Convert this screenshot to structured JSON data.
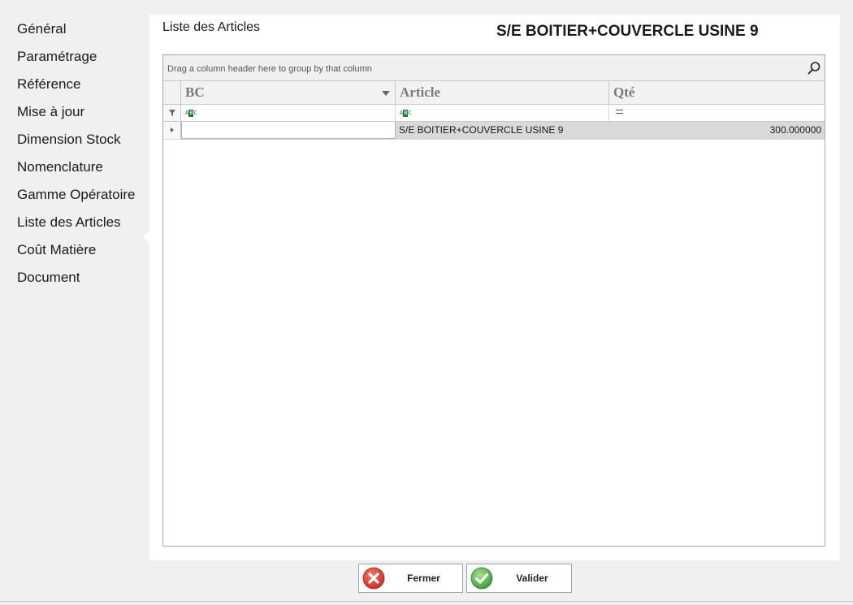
{
  "sidebar": {
    "items": [
      {
        "label": "Général"
      },
      {
        "label": "Paramétrage"
      },
      {
        "label": "Référence"
      },
      {
        "label": "Mise à jour"
      },
      {
        "label": "Dimension Stock"
      },
      {
        "label": "Nomenclature"
      },
      {
        "label": "Gamme Opératoire"
      },
      {
        "label": "Liste des Articles",
        "active": true
      },
      {
        "label": "Coût Matière"
      },
      {
        "label": "Document"
      }
    ]
  },
  "main": {
    "section_title": "Liste des Articles",
    "header_title": "S/E BOITIER+COUVERCLE  USINE 9"
  },
  "grid": {
    "group_hint": "Drag a column header here to group by that column",
    "columns": [
      {
        "label": "BC"
      },
      {
        "label": "Article"
      },
      {
        "label": "Qté"
      }
    ],
    "filter_icons": [
      "abc-text-filter-icon",
      "abc-text-filter-icon",
      "equals-filter-icon"
    ],
    "rows": [
      {
        "bc": "",
        "article": "S/E BOITIER+COUVERCLE  USINE 9",
        "qte": "300.000000"
      }
    ]
  },
  "buttons": {
    "close": {
      "label": "Fermer",
      "icon": "close-icon",
      "color": "#d9342b"
    },
    "validate": {
      "label": "Valider",
      "icon": "check-icon",
      "color": "#3aa64a"
    }
  }
}
